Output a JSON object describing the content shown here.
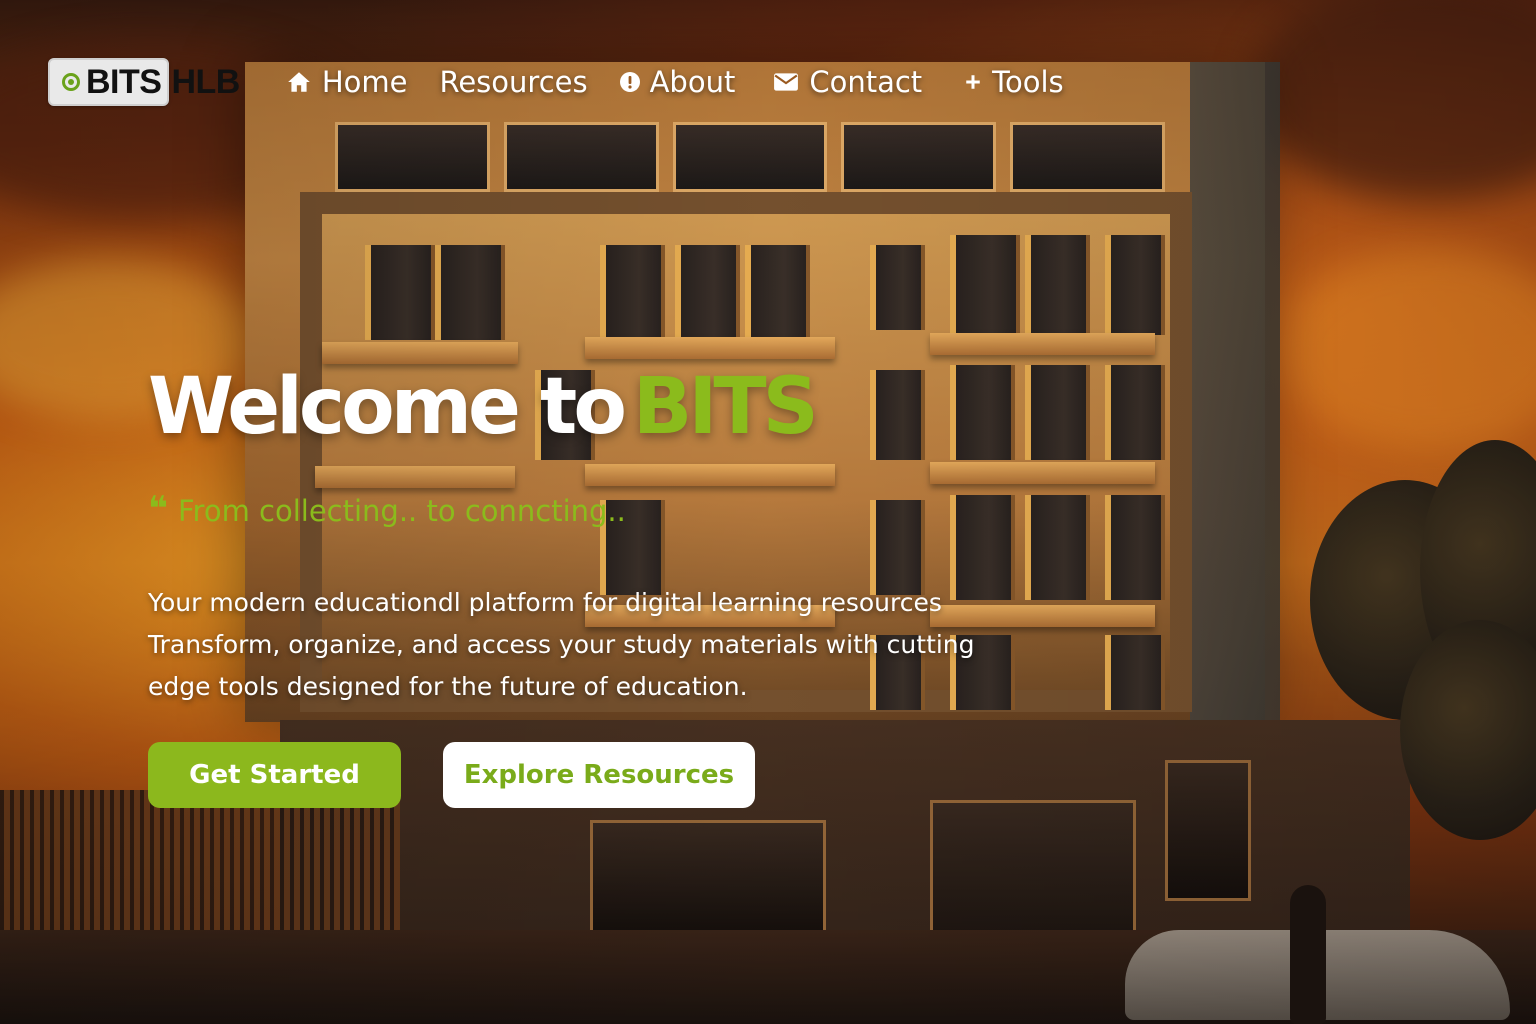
{
  "brand": {
    "logo_part1": "BITS",
    "logo_part2": "HLB",
    "accent_color": "#8cb81d"
  },
  "nav": {
    "items": [
      {
        "label": "Home",
        "icon": "home-icon"
      },
      {
        "label": "Resources",
        "icon": ""
      },
      {
        "label": "About",
        "icon": "info-circle-icon"
      },
      {
        "label": "Contact",
        "icon": "envelope-icon"
      },
      {
        "label": "Tools",
        "icon": "plus-icon"
      }
    ]
  },
  "hero": {
    "title_prefix": "Welcome to",
    "title_accent": "BITS",
    "tagline_quote": "❝",
    "tagline": "From collecting..  to conncting..",
    "description_lines": [
      "Your modern educationdl platform for digital learning resources",
      "Transform, organize, and access your study materials with cutting",
      "edge tools designed for the future of education."
    ],
    "primary_button": "Get Started",
    "secondary_button": "Explore Resources"
  }
}
